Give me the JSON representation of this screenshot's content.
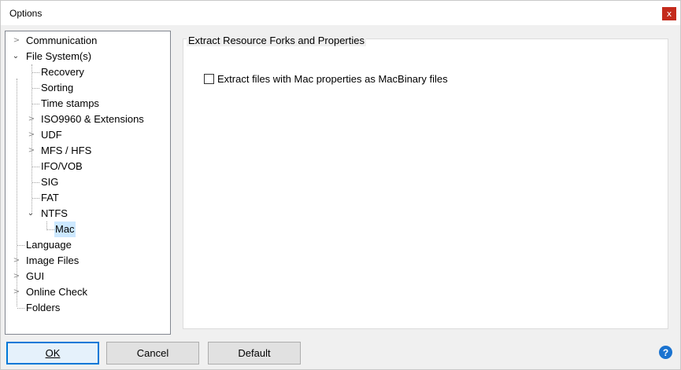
{
  "window": {
    "title": "Options",
    "close_glyph": "x"
  },
  "tree": {
    "items": [
      {
        "label": "Communication",
        "expander": "collapsed"
      },
      {
        "label": "File System(s)",
        "expander": "expanded"
      },
      {
        "label": "Recovery",
        "expander": "none"
      },
      {
        "label": "Sorting",
        "expander": "none"
      },
      {
        "label": "Time stamps",
        "expander": "none"
      },
      {
        "label": "ISO9960 & Extensions",
        "expander": "collapsed"
      },
      {
        "label": "UDF",
        "expander": "collapsed"
      },
      {
        "label": "MFS / HFS",
        "expander": "collapsed"
      },
      {
        "label": "IFO/VOB",
        "expander": "none"
      },
      {
        "label": "SIG",
        "expander": "none"
      },
      {
        "label": "FAT",
        "expander": "none"
      },
      {
        "label": "NTFS",
        "expander": "expanded"
      },
      {
        "label": "Mac",
        "expander": "none",
        "selected": true
      },
      {
        "label": "Language",
        "expander": "none"
      },
      {
        "label": "Image Files",
        "expander": "collapsed"
      },
      {
        "label": "GUI",
        "expander": "collapsed"
      },
      {
        "label": "Online Check",
        "expander": "collapsed"
      },
      {
        "label": "Folders",
        "expander": "none"
      }
    ]
  },
  "content": {
    "group_title": "Extract Resource Forks and Properties",
    "checkbox_label": "Extract files with Mac properties as MacBinary files",
    "checkbox_checked": false
  },
  "buttons": {
    "ok": "OK",
    "cancel": "Cancel",
    "default": "Default"
  },
  "help_glyph": "?",
  "colors": {
    "accent": "#0078d7",
    "selection": "#cce8ff",
    "close": "#c42b1c"
  }
}
